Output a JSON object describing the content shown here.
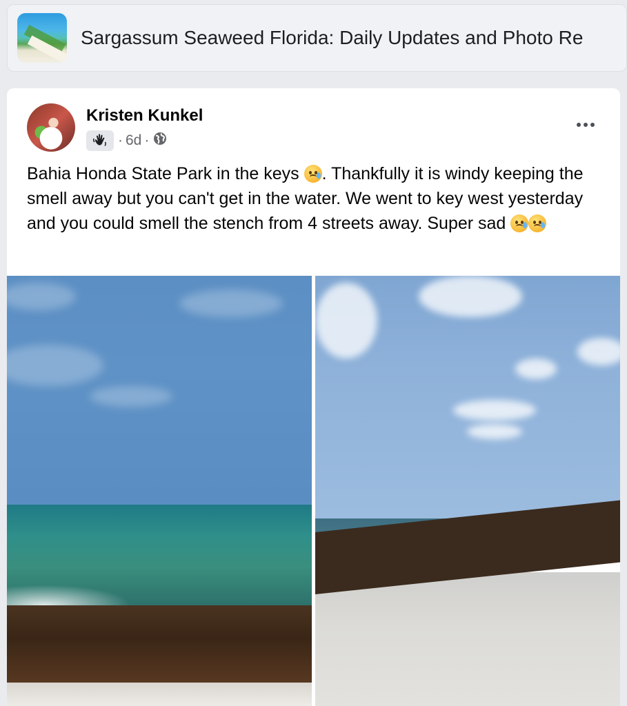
{
  "group": {
    "title": "Sargassum Seaweed Florida: Daily Updates and Photo Re"
  },
  "post": {
    "author": "Kristen Kunkel",
    "badge_icon": "waving-hand-icon",
    "time": "6d",
    "separator": "·",
    "privacy_icon": "globe-icon",
    "text_parts": [
      "Bahia Honda State Park in the keys ",
      ". Thankfully it is windy keeping the smell away but you can't get in the water. We went to key west yesterday and you could smell the stench from 4 streets away. Super sad "
    ],
    "emoji": "sad-but-relieved-face",
    "photos": [
      {
        "subject": "seaweed on shore with green sea"
      },
      {
        "subject": "white sand beach with seaweed line"
      }
    ]
  },
  "colors": {
    "background": "#e9ebee",
    "card": "#ffffff",
    "header": "#f0f2f5",
    "secondary_text": "#65676b"
  }
}
